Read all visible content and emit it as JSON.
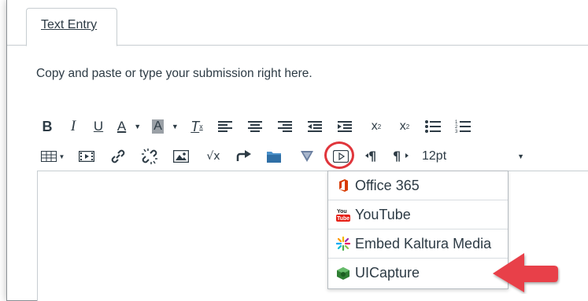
{
  "tabs": [
    {
      "label": "Text Entry"
    }
  ],
  "instructions": "Copy and paste or type your submission right here.",
  "toolbar": {
    "row1": [
      {
        "name": "bold-button",
        "glyph": "B"
      },
      {
        "name": "italic-button",
        "glyph": "I"
      },
      {
        "name": "underline-button",
        "glyph": "U"
      },
      {
        "name": "text-color-button",
        "glyph": "A"
      },
      {
        "name": "background-color-button",
        "glyph": "A"
      },
      {
        "name": "clear-formatting-button",
        "glyph": "T"
      },
      {
        "name": "align-left-button"
      },
      {
        "name": "align-center-button"
      },
      {
        "name": "align-right-button"
      },
      {
        "name": "outdent-button"
      },
      {
        "name": "indent-button"
      },
      {
        "name": "superscript-button",
        "glyph": "x"
      },
      {
        "name": "subscript-button",
        "glyph": "x"
      },
      {
        "name": "bullet-list-button"
      },
      {
        "name": "numbered-list-button"
      }
    ],
    "font_size": "12pt"
  },
  "dropdown_menu": {
    "items": [
      {
        "label": "Office 365",
        "icon": "office365-icon"
      },
      {
        "label": "YouTube",
        "icon": "youtube-icon"
      },
      {
        "label": "Embed Kaltura Media",
        "icon": "kaltura-icon"
      },
      {
        "label": "UICapture",
        "icon": "uicapture-icon"
      }
    ]
  },
  "colors": {
    "highlight": "#e0353b",
    "arrow": "#e84148",
    "office_orange": "#d83b01",
    "youtube_red": "#e62117",
    "uicapture_green": "#2e7d32"
  }
}
